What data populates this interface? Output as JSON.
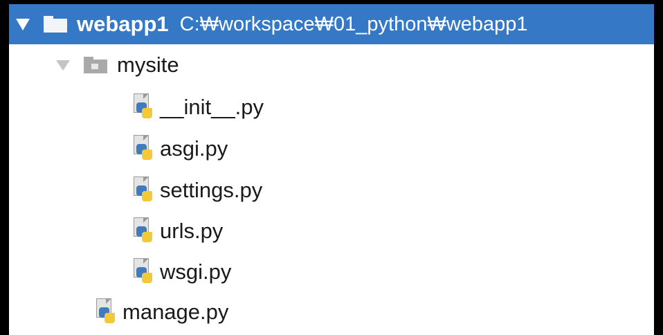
{
  "tree": {
    "project": {
      "name": "webapp1",
      "path": "C:₩workspace₩01_python₩webapp1"
    },
    "package": {
      "name": "mysite",
      "files": [
        "__init__.py",
        "asgi.py",
        "settings.py",
        "urls.py",
        "wsgi.py"
      ]
    },
    "root_file": "manage.py"
  },
  "icons": {
    "expand": "triangle-down-icon",
    "folder": "folder-icon",
    "package": "package-folder-icon",
    "python_file": "python-file-icon"
  },
  "colors": {
    "selection": "#3478c6",
    "python_blue": "#3f7bbf",
    "python_yellow": "#f3c93a"
  }
}
